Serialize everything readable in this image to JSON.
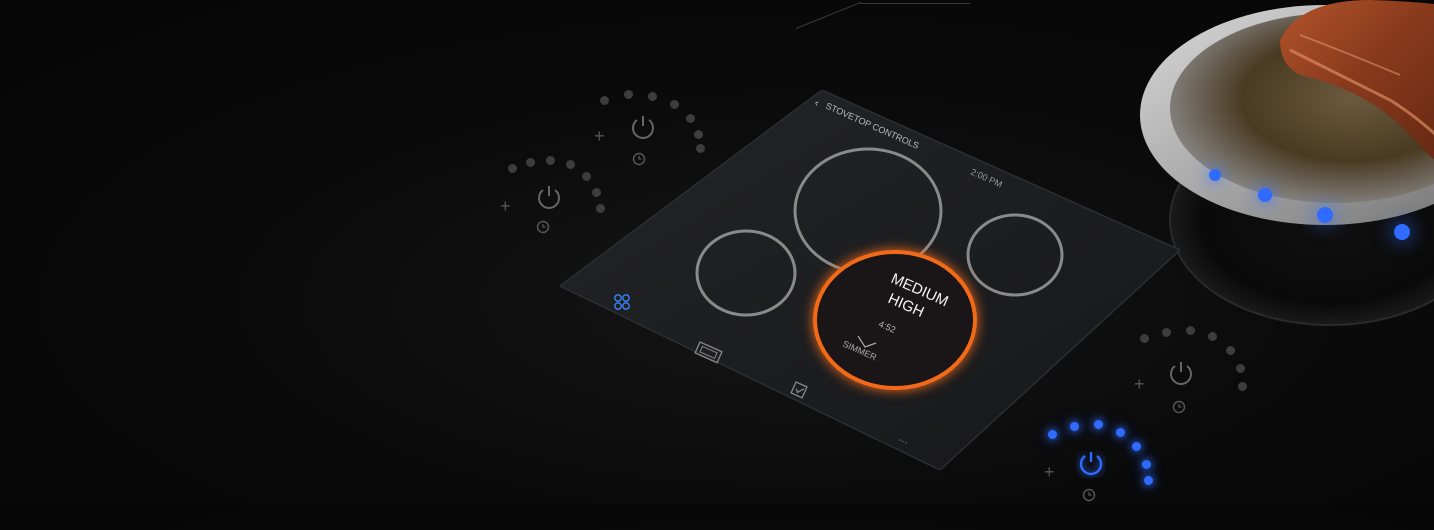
{
  "panel": {
    "title": "STOVETOP CONTROLS",
    "back_icon": "back-chevron-icon",
    "time": "2:00 PM",
    "active_burner": {
      "level": "MEDIUM HIGH",
      "level_line1": "MEDIUM",
      "level_line2": "HIGH",
      "timer": "4:52",
      "next_level": "SIMMER"
    },
    "nav": [
      "burners-icon",
      "oven-icon",
      "check-icon",
      "more-icon"
    ],
    "more": "..."
  },
  "colors": {
    "accent_blue": "#2f6bff",
    "burner_orange": "#f06a1a",
    "panel_bg": "#1c1d1f",
    "ring_grey": "#8a8a8a"
  },
  "knobs": [
    {
      "name": "knob-rear-left",
      "active": false
    },
    {
      "name": "knob-front-left",
      "active": false
    },
    {
      "name": "knob-rear-right",
      "active": false
    },
    {
      "name": "knob-front-right",
      "active": true
    }
  ]
}
